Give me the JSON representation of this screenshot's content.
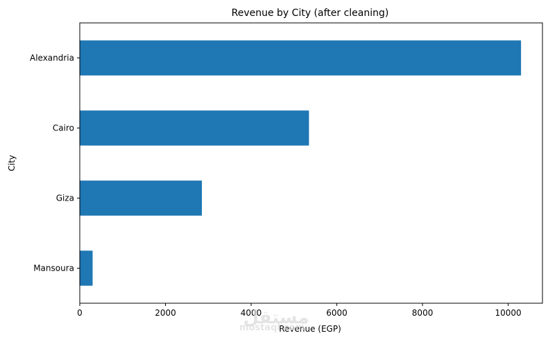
{
  "chart_data": {
    "type": "bar",
    "orientation": "horizontal",
    "title": "Revenue by City (after cleaning)",
    "xlabel": "Revenue (EGP)",
    "ylabel": "City",
    "categories": [
      "Alexandria",
      "Cairo",
      "Giza",
      "Mansoura"
    ],
    "values": [
      10300,
      5350,
      2850,
      300
    ],
    "xlim": [
      0,
      10800
    ],
    "xticks": [
      0,
      2000,
      4000,
      6000,
      8000,
      10000
    ],
    "bar_color": "#1f77b4",
    "grid": false,
    "legend": "none"
  },
  "watermark": {
    "glyph": "مستقل",
    "text": "mostaql.com"
  }
}
